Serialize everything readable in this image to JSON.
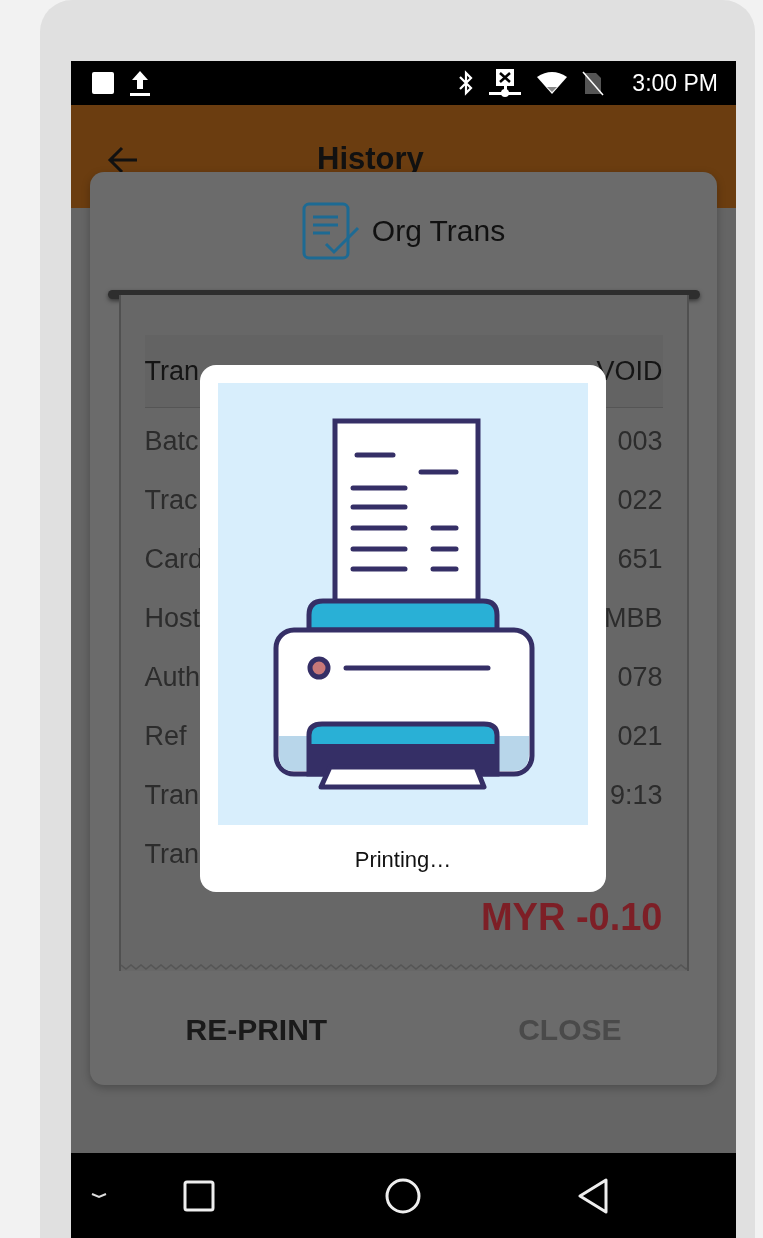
{
  "status_bar": {
    "time": "3:00 PM"
  },
  "app_bar": {
    "title": "History"
  },
  "dialog": {
    "title": "Org Trans",
    "rows": [
      {
        "kind": "header",
        "label": "Tran",
        "value": "VOID"
      },
      {
        "kind": "detail",
        "label": "Batc",
        "value": "003"
      },
      {
        "kind": "detail",
        "label": "Trac",
        "value": "022"
      },
      {
        "kind": "detail",
        "label": "Card",
        "value": "651"
      },
      {
        "kind": "detail",
        "label": "Host",
        "value": "MBB"
      },
      {
        "kind": "detail",
        "label": "Auth",
        "value": "078"
      },
      {
        "kind": "detail",
        "label": "Ref",
        "value": "021"
      },
      {
        "kind": "detail",
        "label": "Tran",
        "value": "9:13"
      },
      {
        "kind": "detail",
        "label": "Tran"
      }
    ],
    "amount": "MYR -0.10",
    "buttons": [
      {
        "label": "RE-PRINT",
        "disabled": false
      },
      {
        "label": "CLOSE",
        "disabled": true
      }
    ]
  },
  "printing_popup": {
    "message": "Printing…"
  }
}
